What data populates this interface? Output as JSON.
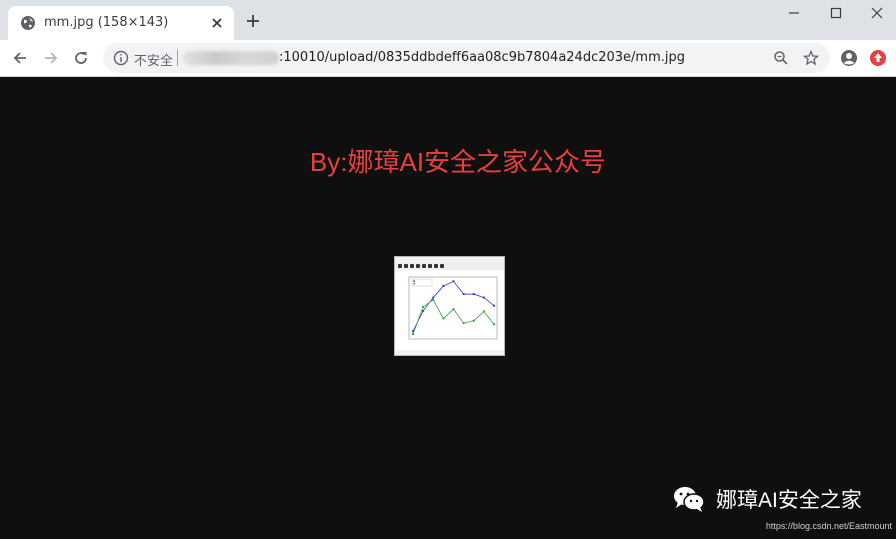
{
  "browser": {
    "tab_title": "mm.jpg (158×143)",
    "security_label": "不安全",
    "url_visible": ":10010/upload/0835ddbdeff6aa08c9b7804a24dc203e/mm.jpg"
  },
  "page": {
    "overlay_title": "By:娜璋AI安全之家公众号",
    "bottom_watermark": "娜璋AI安全之家",
    "credit": "https://blog.csdn.net/Eastmount"
  },
  "thumbnail_chart": {
    "type": "line",
    "series": [
      {
        "color": "#3a3ad0",
        "values": [
          10,
          45,
          68,
          88,
          96,
          74,
          74,
          68,
          54
        ]
      },
      {
        "color": "#3aa33a",
        "values": [
          5,
          52,
          64,
          32,
          48,
          24,
          28,
          44,
          22
        ]
      }
    ],
    "ylim": [
      0,
      100
    ]
  },
  "colors": {
    "title_red": "#e8403e",
    "page_bg": "#0f0f0f"
  }
}
